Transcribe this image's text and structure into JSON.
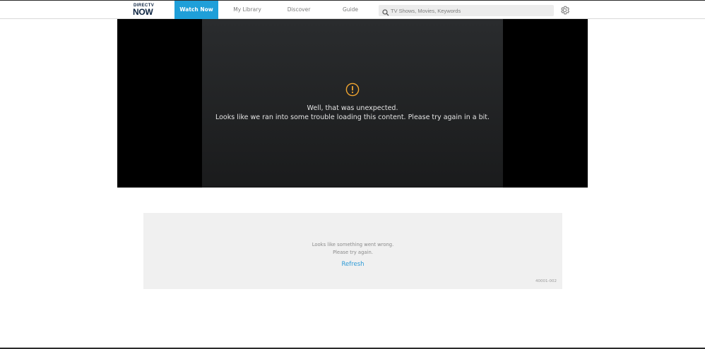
{
  "brand": {
    "line1": "DIRECTV",
    "line2": "NOW"
  },
  "nav": {
    "tabs": [
      {
        "label": "Watch Now",
        "active": true
      },
      {
        "label": "My Library",
        "active": false
      },
      {
        "label": "Discover",
        "active": false
      },
      {
        "label": "Guide",
        "active": false
      }
    ]
  },
  "search": {
    "placeholder": "TV Shows, Movies, Keywords",
    "value": "",
    "icon": "search-icon"
  },
  "settings": {
    "icon": "gear-icon"
  },
  "player": {
    "icon": "exclamation-circle-icon",
    "message_line1": "Well, that was unexpected.",
    "message_line2": "Looks like we ran into some trouble loading this content. Please try again in a bit."
  },
  "error_card": {
    "line1": "Looks like something went wrong.",
    "line2": "Please try again.",
    "refresh_label": "Refresh",
    "error_code": "40001-002"
  },
  "colors": {
    "accent": "#1f9fd9",
    "link": "#2e9ad6",
    "warning": "#f0a530",
    "brand_navy": "#0c2340"
  }
}
